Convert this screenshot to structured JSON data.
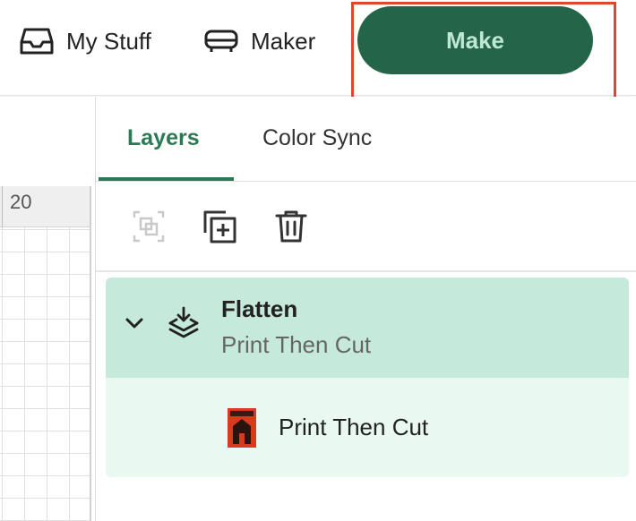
{
  "header": {
    "nav": [
      {
        "label": "My Stuff",
        "icon": "tray-icon"
      },
      {
        "label": "Maker",
        "icon": "machine-icon"
      }
    ],
    "make_label": "Make",
    "make_color": "#246549",
    "highlight_color": "#e2462e"
  },
  "canvas": {
    "ruler_label": "20"
  },
  "panel": {
    "tabs": [
      {
        "label": "Layers",
        "active": true
      },
      {
        "label": "Color Sync",
        "active": false
      }
    ],
    "toolbar": [
      {
        "icon": "group-icon",
        "enabled": false
      },
      {
        "icon": "duplicate-icon",
        "enabled": true
      },
      {
        "icon": "trash-icon",
        "enabled": true
      }
    ],
    "layer_group": {
      "title": "Flatten",
      "subtitle": "Print Then Cut",
      "expanded": true
    },
    "layer_child": {
      "label": "Print Then Cut"
    }
  }
}
